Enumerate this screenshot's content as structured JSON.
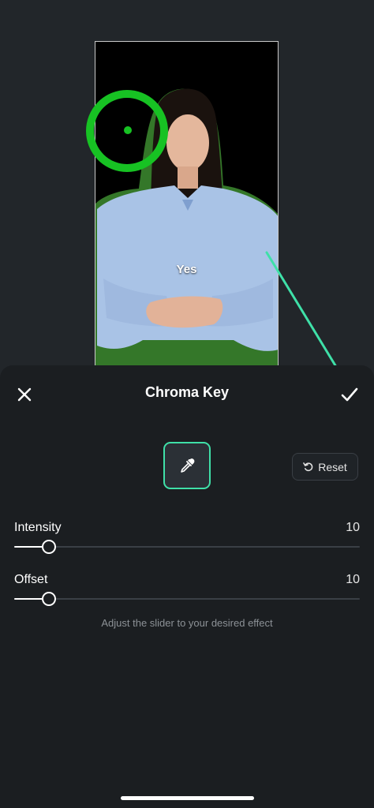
{
  "preview": {
    "caption": "Yes",
    "picker_color": "#17c223"
  },
  "annotation": {
    "arrow_color": "#3fe0a8"
  },
  "panel": {
    "title": "Chroma Key",
    "close_icon": "close-icon",
    "confirm_icon": "checkmark-icon",
    "eyedropper_icon": "eyedropper-icon",
    "reset_label": "Reset",
    "reset_icon": "reset-icon"
  },
  "sliders": [
    {
      "label": "Intensity",
      "value": "10",
      "fraction": 0.1
    },
    {
      "label": "Offset",
      "value": "10",
      "fraction": 0.1
    }
  ],
  "hint": "Adjust the slider to your desired effect",
  "colors": {
    "accent": "#3fe0a8",
    "panel_bg": "#1b1e21",
    "page_bg": "#22262a"
  }
}
